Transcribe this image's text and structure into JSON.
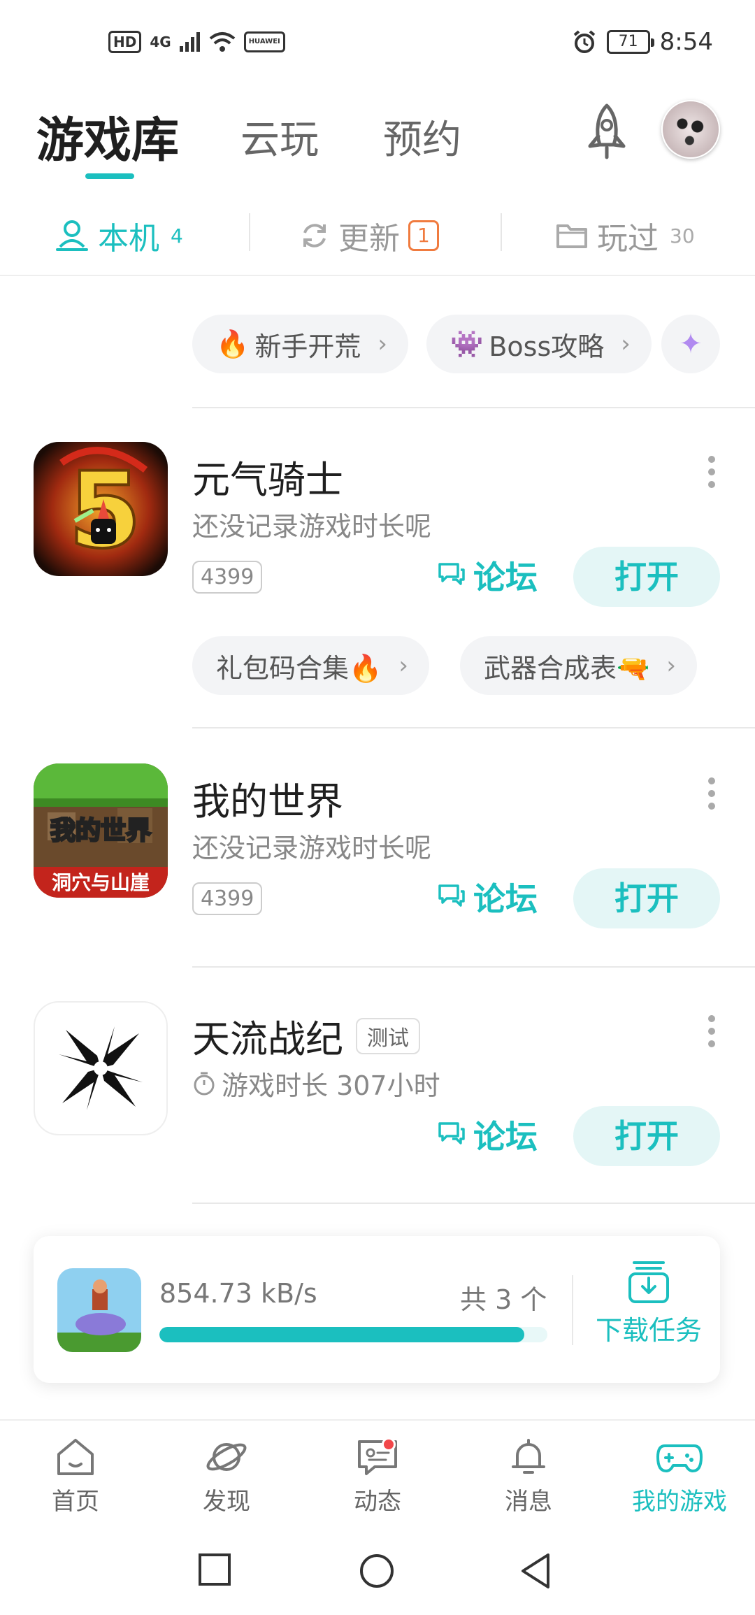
{
  "status_bar": {
    "hd": "HD",
    "signal": "4G",
    "carrier_icon": "HUAWEI",
    "battery": "71",
    "time": "8:54"
  },
  "header": {
    "tabs": [
      "游戏库",
      "云玩",
      "预约"
    ]
  },
  "subtabs": {
    "local": {
      "label": "本机",
      "count": "4"
    },
    "update": {
      "label": "更新",
      "count": "1"
    },
    "played": {
      "label": "玩过",
      "count": "30"
    }
  },
  "top_chips": [
    {
      "label": "新手开荒",
      "emoji": "🔥"
    },
    {
      "label": "Boss攻略",
      "emoji": "👾"
    }
  ],
  "games": [
    {
      "title": "元气骑士",
      "subtitle": "还没记录游戏时长呢",
      "badge": "4399",
      "forum": "论坛",
      "open": "打开",
      "chips": [
        "礼包码合集🔥",
        "武器合成表🔫"
      ]
    },
    {
      "title": "我的世界",
      "subtitle": "还没记录游戏时长呢",
      "badge": "4399",
      "forum": "论坛",
      "open": "打开"
    },
    {
      "title": "天流战纪",
      "tag": "测试",
      "subtitle": "游戏时长 307小时",
      "forum": "论坛",
      "open": "打开"
    }
  ],
  "download": {
    "speed": "854.73 kB/s",
    "count": "共 3 个",
    "progress": 0.94,
    "task_label": "下载任务"
  },
  "bottom_nav": [
    "首页",
    "发现",
    "动态",
    "消息",
    "我的游戏"
  ],
  "colors": {
    "accent": "#1bbfbf",
    "badge_orange": "#f07b3f",
    "dot_red": "#f2474a"
  }
}
